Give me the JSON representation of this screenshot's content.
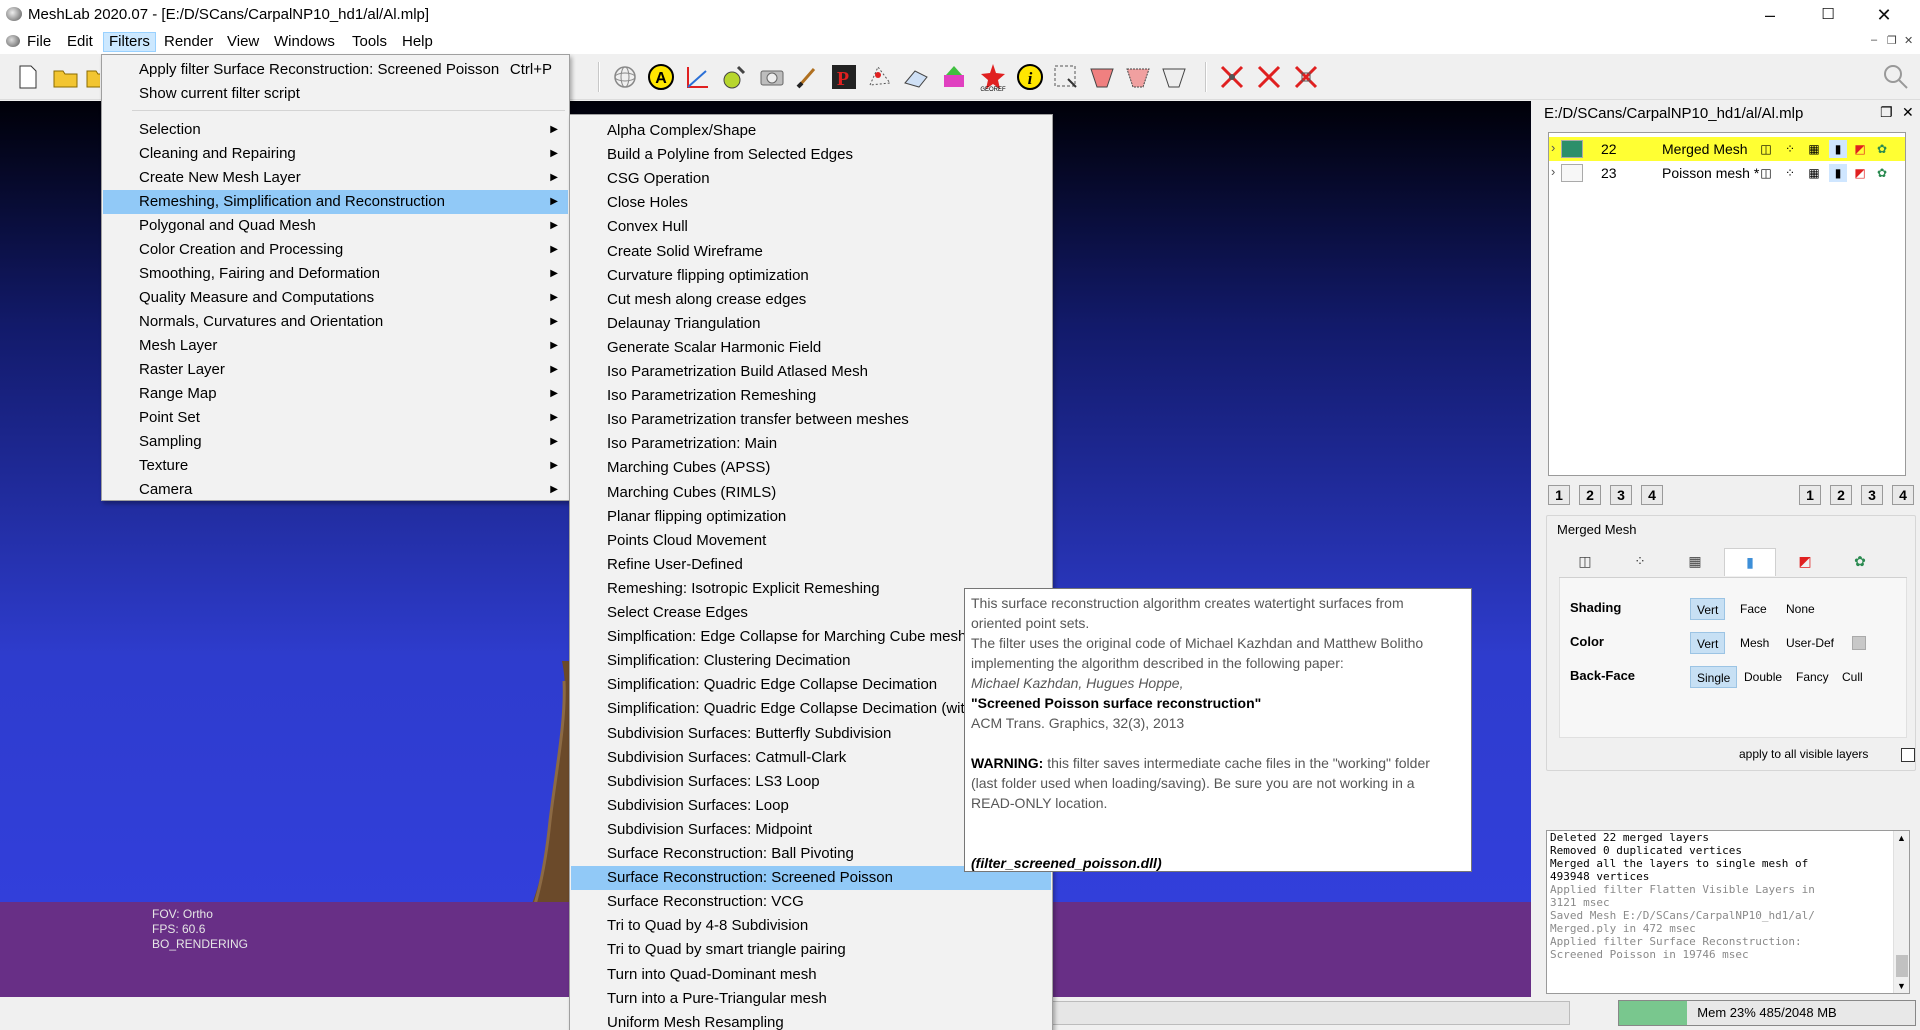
{
  "window": {
    "title": "MeshLab 2020.07 - [E:/D/SCans/CarpalNP10_hd1/al/Al.mlp]",
    "controls": {
      "minimize": "–",
      "maximize": "☐",
      "close": "✕"
    }
  },
  "menubar": {
    "items": [
      "File",
      "Edit",
      "Filters",
      "Render",
      "View",
      "Windows",
      "Tools",
      "Help"
    ],
    "active": "Filters",
    "mdi_controls": [
      "–",
      "❐",
      "✕"
    ]
  },
  "filters_menu": {
    "top_items": [
      {
        "label": "Apply filter Surface Reconstruction: Screened Poisson",
        "shortcut": "Ctrl+P"
      },
      {
        "label": "Show current filter script",
        "shortcut": ""
      }
    ],
    "submenus": [
      "Selection",
      "Cleaning and Repairing",
      "Create New Mesh Layer",
      "Remeshing, Simplification and Reconstruction",
      "Polygonal and Quad Mesh",
      "Color Creation and Processing",
      "Smoothing, Fairing and Deformation",
      "Quality Measure and Computations",
      "Normals, Curvatures and Orientation",
      "Mesh Layer",
      "Raster Layer",
      "Range Map",
      "Point Set",
      "Sampling",
      "Texture",
      "Camera"
    ],
    "highlighted": "Remeshing, Simplification and Reconstruction"
  },
  "remeshing_menu": {
    "items": [
      "Alpha Complex/Shape",
      "Build a Polyline from Selected Edges",
      "CSG Operation",
      "Close Holes",
      "Convex Hull",
      "Create Solid Wireframe",
      "Curvature flipping optimization",
      "Cut mesh along crease edges",
      "Delaunay Triangulation",
      "Generate Scalar Harmonic Field",
      "Iso Parametrization Build Atlased Mesh",
      "Iso Parametrization Remeshing",
      "Iso Parametrization transfer between meshes",
      "Iso Parametrization: Main",
      "Marching Cubes (APSS)",
      "Marching Cubes (RIMLS)",
      "Planar flipping optimization",
      "Points Cloud Movement",
      "Refine User-Defined",
      "Remeshing: Isotropic Explicit Remeshing",
      "Select Crease Edges",
      "Simplfication: Edge Collapse for Marching Cube meshe",
      "Simplification: Clustering Decimation",
      "Simplification: Quadric Edge Collapse Decimation",
      "Simplification: Quadric Edge Collapse Decimation (wit",
      "Subdivision Surfaces: Butterfly Subdivision",
      "Subdivision Surfaces: Catmull-Clark",
      "Subdivision Surfaces: LS3 Loop",
      "Subdivision Surfaces: Loop",
      "Subdivision Surfaces: Midpoint",
      "Surface Reconstruction: Ball Pivoting",
      "Surface Reconstruction: Screened Poisson",
      "Surface Reconstruction: VCG",
      "Tri to Quad by 4-8 Subdivision",
      "Tri to Quad by smart triangle pairing",
      "Turn into Quad-Dominant mesh",
      "Turn into a Pure-Triangular mesh",
      "Uniform Mesh Resampling"
    ],
    "highlighted": "Surface Reconstruction: Screened Poisson"
  },
  "tooltip": {
    "line1": "This surface reconstruction algorithm creates watertight surfaces from",
    "line2": "oriented point sets.",
    "line3": "The filter uses the original code of Michael Kazhdan and Matthew Bolitho",
    "line4": "implementing the algorithm described in the following paper:",
    "authors": "Michael Kazhdan, Hugues Hoppe,",
    "paper_title": "\"Screened Poisson surface reconstruction\"",
    "journal": "ACM Trans. Graphics, 32(3), 2013",
    "warning_label": "WARNING:",
    "warning_line1": " this filter saves intermediate cache files in the \"working\" folder",
    "warning_line2": "(last folder used when loading/saving). Be sure you are not working in a",
    "warning_line3": "READ-ONLY location.",
    "plugin": "(filter_screened_poisson.dll)"
  },
  "viewport": {
    "info_lines": [
      "FOV: Ortho",
      "FPS:   60.6",
      "BO_RENDERING"
    ],
    "colors": {
      "top": "#000008",
      "bottom": "#3340e0",
      "band": "#682f86"
    }
  },
  "layers_panel": {
    "title": "E:/D/SCans/CarpalNP10_hd1/al/Al.mlp",
    "layers": [
      {
        "id": "22",
        "name": "Merged Mesh",
        "selected": true
      },
      {
        "id": "23",
        "name": "Poisson mesh *",
        "selected": false
      }
    ],
    "view_buttons_left": [
      "1",
      "2",
      "3",
      "4"
    ],
    "view_buttons_right": [
      "1",
      "2",
      "3",
      "4"
    ],
    "current_mesh": "Merged Mesh",
    "tab_icons": [
      "box-icon",
      "points-icon",
      "wireframe-icon",
      "solid-icon",
      "texture-icon",
      "settings-icon"
    ],
    "shading": {
      "label": "Shading",
      "options": [
        "Vert",
        "Face",
        "None"
      ],
      "selected": "Vert"
    },
    "color": {
      "label": "Color",
      "options": [
        "Vert",
        "Mesh",
        "User-Def"
      ],
      "selected": "Vert"
    },
    "backface": {
      "label": "Back-Face",
      "options": [
        "Single",
        "Double",
        "Fancy",
        "Cull"
      ],
      "selected": "Single"
    },
    "apply_all": "apply to all visible layers"
  },
  "log": [
    {
      "text": "Deleted 22 merged layers",
      "dim": false
    },
    {
      "text": "Removed 0 duplicated vertices",
      "dim": false
    },
    {
      "text": "Merged all the layers to single mesh of",
      "dim": false
    },
    {
      "text": "493948 vertices",
      "dim": false
    },
    {
      "text": "Applied filter Flatten Visible Layers in",
      "dim": true
    },
    {
      "text": "3121 msec",
      "dim": true
    },
    {
      "text": "Saved Mesh E:/D/SCans/CarpalNP10_hd1/al/",
      "dim": true
    },
    {
      "text": "Merged.ply in 472 msec",
      "dim": true
    },
    {
      "text": "Applied filter Surface Reconstruction:",
      "dim": true
    },
    {
      "text": "Screened Poisson in 19746 msec",
      "dim": true
    }
  ],
  "statusbar": {
    "memory_text": "Mem 23% 485/2048 MB",
    "memory_fraction": 0.23
  }
}
